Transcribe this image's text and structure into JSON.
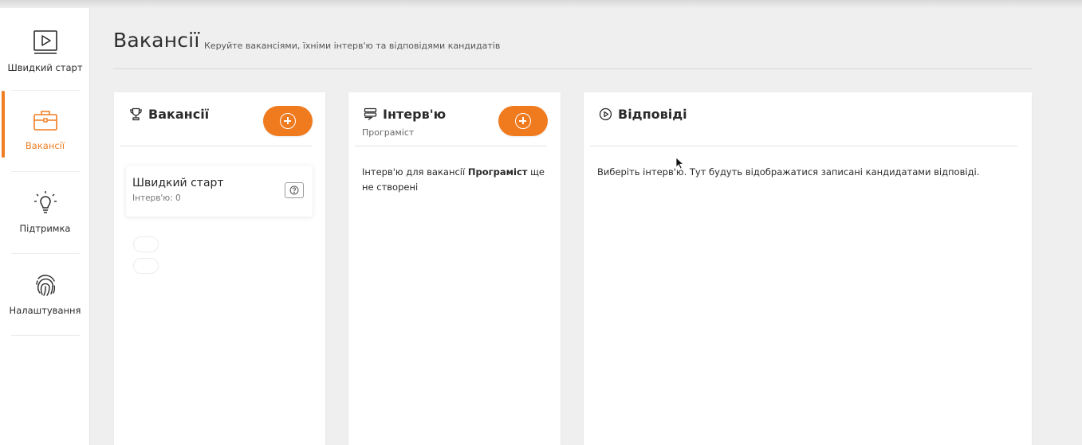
{
  "sidebar": {
    "items": [
      {
        "label": "Швидкий старт",
        "icon": "play-video-icon",
        "active": false
      },
      {
        "label": "Вакансії",
        "icon": "briefcase-icon",
        "active": true
      },
      {
        "label": "Підтримка",
        "icon": "lightbulb-icon",
        "active": false
      },
      {
        "label": "Налаштування",
        "icon": "fingerprint-icon",
        "active": false
      }
    ]
  },
  "header": {
    "title": "Вакансії",
    "subtitle": "Керуйте вакансіями, їхніми інтерв'ю та відповідями кандидатів"
  },
  "vacancies_panel": {
    "title": "Вакансії",
    "icon": "trophy-icon",
    "add_icon": "plus-circle-icon",
    "items": [
      {
        "name": "Швидкий старт",
        "meta": "Інтерв'ю: 0",
        "action_icon": "help-circle-icon"
      }
    ]
  },
  "interviews_panel": {
    "title": "Інтерв'ю",
    "icon": "list-chat-icon",
    "subtitle": "Програміст",
    "add_icon": "plus-circle-icon",
    "empty_prefix": "Інтерв'ю для вакансії ",
    "empty_vacancy": "Програміст",
    "empty_suffix": " ще не створені"
  },
  "responses_panel": {
    "title": "Відповіді",
    "icon": "play-circle-icon",
    "empty_text": "Виберіть інтерв'ю. Тут будуть відображатися записані кандидатами відповіді."
  },
  "colors": {
    "accent": "#f07b1f",
    "background": "#efefef",
    "card": "#ffffff",
    "text": "#2a2a2a"
  }
}
